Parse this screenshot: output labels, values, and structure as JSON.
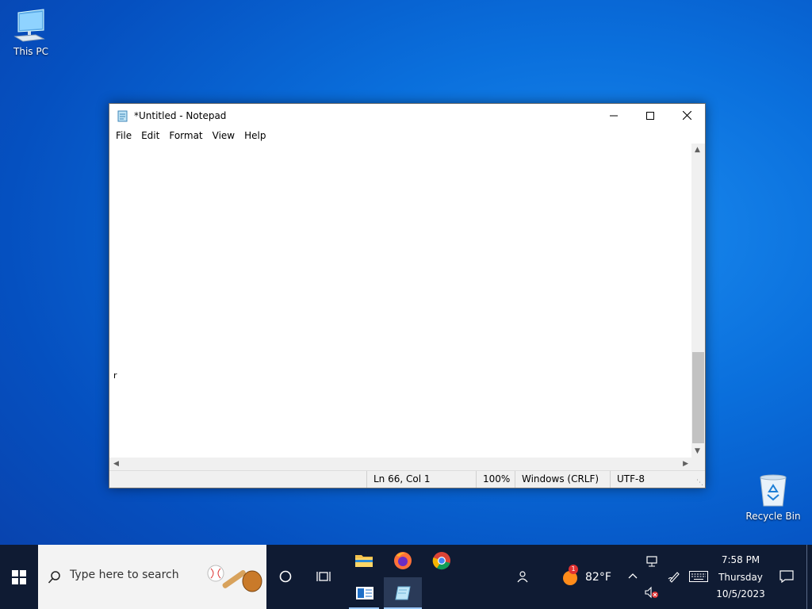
{
  "desktop": {
    "icons": [
      {
        "label": "This PC"
      },
      {
        "label": "Recycle Bin"
      }
    ]
  },
  "window": {
    "title": "*Untitled - Notepad",
    "menu": [
      "File",
      "Edit",
      "Format",
      "View",
      "Help"
    ],
    "content_visible_char": "r",
    "status": {
      "position": "Ln 66, Col 1",
      "zoom": "100%",
      "line_endings": "Windows (CRLF)",
      "encoding": "UTF-8"
    }
  },
  "taskbar": {
    "search_placeholder": "Type here to search",
    "weather_temp": "82°F",
    "weather_badge": "1",
    "clock_time": "7:58 PM",
    "clock_day": "Thursday",
    "clock_date": "10/5/2023",
    "pinned": [
      "file-explorer",
      "firefox",
      "chrome",
      "news",
      "notepad"
    ]
  },
  "colors": {
    "taskbar_bg": "#0f1b33",
    "accent": "#9cc9ff"
  }
}
